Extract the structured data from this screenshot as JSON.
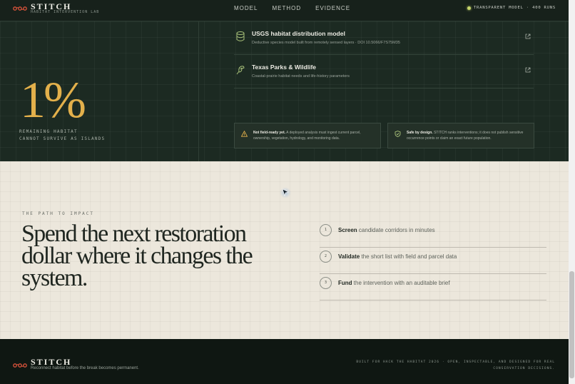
{
  "nav": {
    "brand": "STITCH",
    "brand_sub": "HABITAT INTERVENTION LAB",
    "links": [
      "MODEL",
      "METHOD",
      "EVIDENCE"
    ],
    "status": "TRANSPARENT MODEL · 400 RUNS"
  },
  "stat": {
    "value": "1%",
    "caption_line1": "REMAINING HABITAT",
    "caption_line2": "CANNOT SURVIVE AS ISLANDS"
  },
  "sources": [
    {
      "icon": "database-icon",
      "title": "USGS habitat distribution model",
      "desc": "Deductive species model built from remotely sensed layers · DOI 10.5066/F7S75M35"
    },
    {
      "icon": "bird-icon",
      "title": "Texas Parks & Wildlife",
      "desc": "Coastal-prairie habitat needs and life-history parameters"
    }
  ],
  "notes": [
    {
      "icon": "warning-icon",
      "title": "Not field-ready yet.",
      "body": "A deployed analysis must ingest current parcel, ownership, vegetation, hydrology, and monitoring data."
    },
    {
      "icon": "shield-icon",
      "title": "Safe by design.",
      "body": "STITCH ranks interventions; it does not publish sensitive occurrence points or claim an exact future population."
    }
  ],
  "impact": {
    "eyebrow": "THE PATH TO IMPACT",
    "headline": "Spend the next restoration dollar where it changes the system."
  },
  "steps": [
    {
      "num": "1",
      "verb": "Screen",
      "rest": "candidate corridors in minutes"
    },
    {
      "num": "2",
      "verb": "Validate",
      "rest": "the short list with field and parcel data"
    },
    {
      "num": "3",
      "verb": "Fund",
      "rest": "the intervention with an auditable brief"
    }
  ],
  "footer": {
    "brand": "STITCH",
    "tagline": "Reconnect habitat before the break becomes permanent.",
    "credit": "BUILT FOR HACK THE HABITAT 2026 · OPEN, INSPECTABLE, AND DESIGNED FOR REAL CONSERVATION DECISIONS."
  },
  "colors": {
    "accent_gold": "#e3b04b",
    "accent_green": "#a9c27a",
    "logo_red": "#d9533b",
    "dark_bg": "#1c2a22",
    "light_bg": "#ece7dc"
  }
}
